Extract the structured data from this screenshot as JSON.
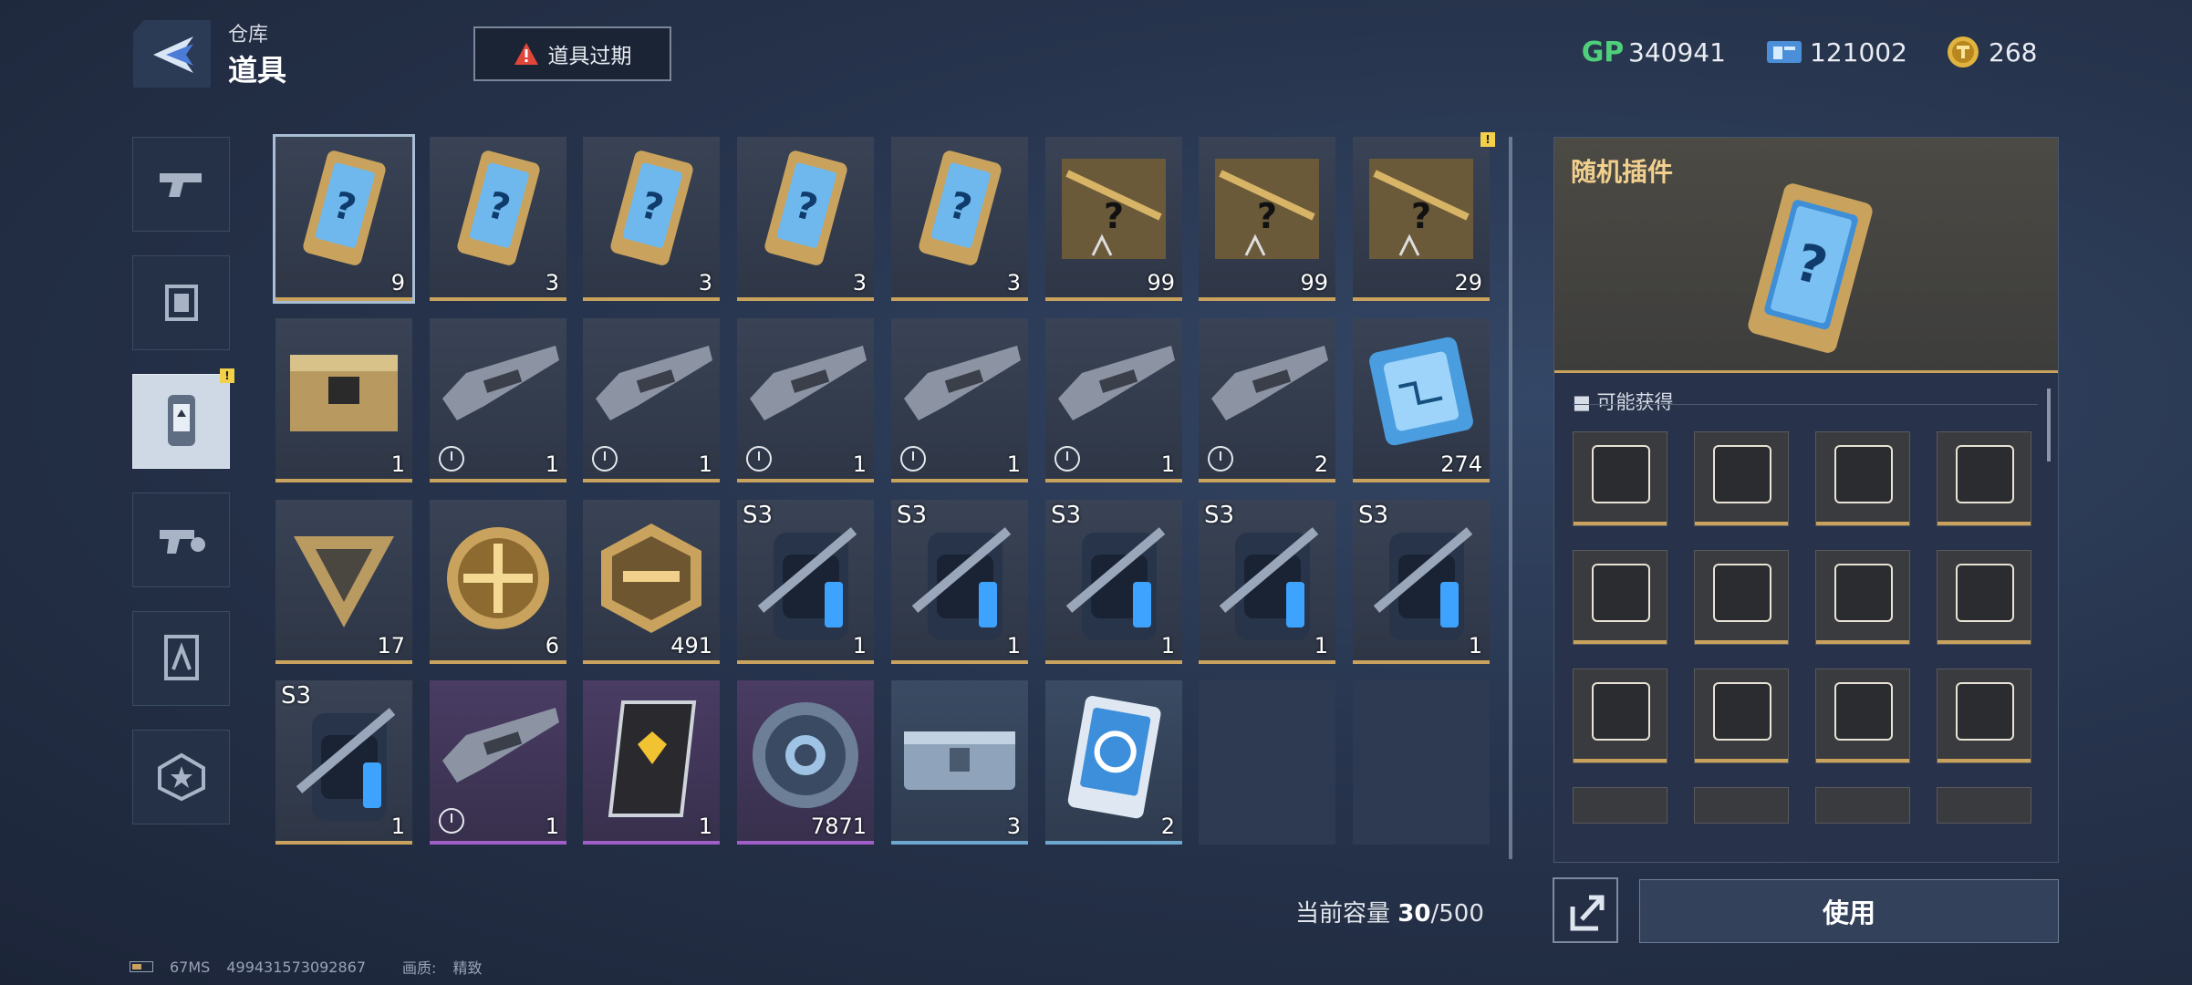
{
  "header": {
    "subtitle": "仓库",
    "title": "道具",
    "expire_button": "道具过期"
  },
  "currencies": [
    {
      "icon": "gp-icon",
      "label": "GP",
      "value": "340941"
    },
    {
      "icon": "ticket-icon",
      "value": "121002"
    },
    {
      "icon": "coin-icon",
      "value": "268"
    }
  ],
  "sidebar": {
    "items": [
      {
        "icon": "pistol-icon"
      },
      {
        "icon": "frame-icon"
      },
      {
        "icon": "plugin-icon",
        "active": true
      },
      {
        "icon": "hand-gun-icon"
      },
      {
        "icon": "blueprint-icon"
      },
      {
        "icon": "star-badge-icon"
      }
    ]
  },
  "grid": {
    "items": [
      {
        "icon": "random-plugin-card-icon",
        "count": "9"
      },
      {
        "icon": "random-plugin-card-icon",
        "count": "3"
      },
      {
        "icon": "random-plugin-card-icon",
        "count": "3"
      },
      {
        "icon": "random-plugin-card-icon",
        "count": "3"
      },
      {
        "icon": "random-plugin-card-icon",
        "count": "3"
      },
      {
        "icon": "sniper-blueprint-icon",
        "count": "99"
      },
      {
        "icon": "sniper-blueprint-icon",
        "count": "99"
      },
      {
        "icon": "sniper-blueprint-icon",
        "count": "29"
      },
      {
        "icon": "supply-crate-icon",
        "count": "1"
      },
      {
        "icon": "rifle-trial-icon",
        "count": "1"
      },
      {
        "icon": "rifle-trial-icon",
        "count": "1"
      },
      {
        "icon": "rifle-trial-icon",
        "count": "1"
      },
      {
        "icon": "rifle-trial-icon",
        "count": "1"
      },
      {
        "icon": "rifle-trial-icon",
        "count": "1"
      },
      {
        "icon": "rifle-trial-icon",
        "count": "2"
      },
      {
        "icon": "chip-icon",
        "count": "274"
      },
      {
        "icon": "triangle-emblem-icon",
        "count": "17"
      },
      {
        "icon": "cross-medal-icon",
        "count": "6"
      },
      {
        "icon": "gun-badge-icon",
        "count": "491"
      },
      {
        "icon": "backpack-icon",
        "count": "1",
        "season": "S3"
      },
      {
        "icon": "backpack-icon",
        "count": "1",
        "season": "S3"
      },
      {
        "icon": "backpack-icon",
        "count": "1",
        "season": "S3"
      },
      {
        "icon": "backpack-icon",
        "count": "1",
        "season": "S3"
      },
      {
        "icon": "backpack-icon",
        "count": "1",
        "season": "S3"
      },
      {
        "icon": "backpack-icon",
        "count": "1",
        "season": "S3"
      },
      {
        "icon": "rifle-trial-icon",
        "count": "1"
      },
      {
        "icon": "rank-card-icon",
        "count": "1"
      },
      {
        "icon": "ring-token-icon",
        "count": "7871"
      },
      {
        "icon": "metal-case-icon",
        "count": "3"
      },
      {
        "icon": "refresh-card-icon",
        "count": "2"
      },
      {
        "icon": "empty-slot"
      },
      {
        "icon": "empty-slot"
      }
    ]
  },
  "detail": {
    "name": "随机插件",
    "obtain_label": "可能获得",
    "plugins": [
      {
        "icon": "plugin-spikes-icon"
      },
      {
        "icon": "plugin-circle-slash-icon"
      },
      {
        "icon": "plugin-bullets-up-icon"
      },
      {
        "icon": "plugin-target-icon"
      },
      {
        "icon": "plugin-ammo-warning-icon"
      },
      {
        "icon": "plugin-crosshair-icon"
      },
      {
        "icon": "plugin-rockets-icon"
      },
      {
        "icon": "plugin-gun-up-icon"
      },
      {
        "icon": "plugin-shield-x-icon"
      },
      {
        "icon": "plugin-reticle-up-icon"
      },
      {
        "icon": "plugin-wings-icon"
      },
      {
        "icon": "plugin-fist-icon"
      }
    ]
  },
  "capacity": {
    "label": "当前容量",
    "current": "30",
    "max": "/500"
  },
  "use_button": "使用",
  "footer": {
    "ping": "67MS",
    "uid": "499431573092867",
    "quality_label": "画质:",
    "quality_value": "精致"
  },
  "colors": {
    "gold": "#c9a35d",
    "purple": "#a05ec8",
    "blue": "#6ea7cf",
    "gp_green": "#4fcf7a"
  }
}
